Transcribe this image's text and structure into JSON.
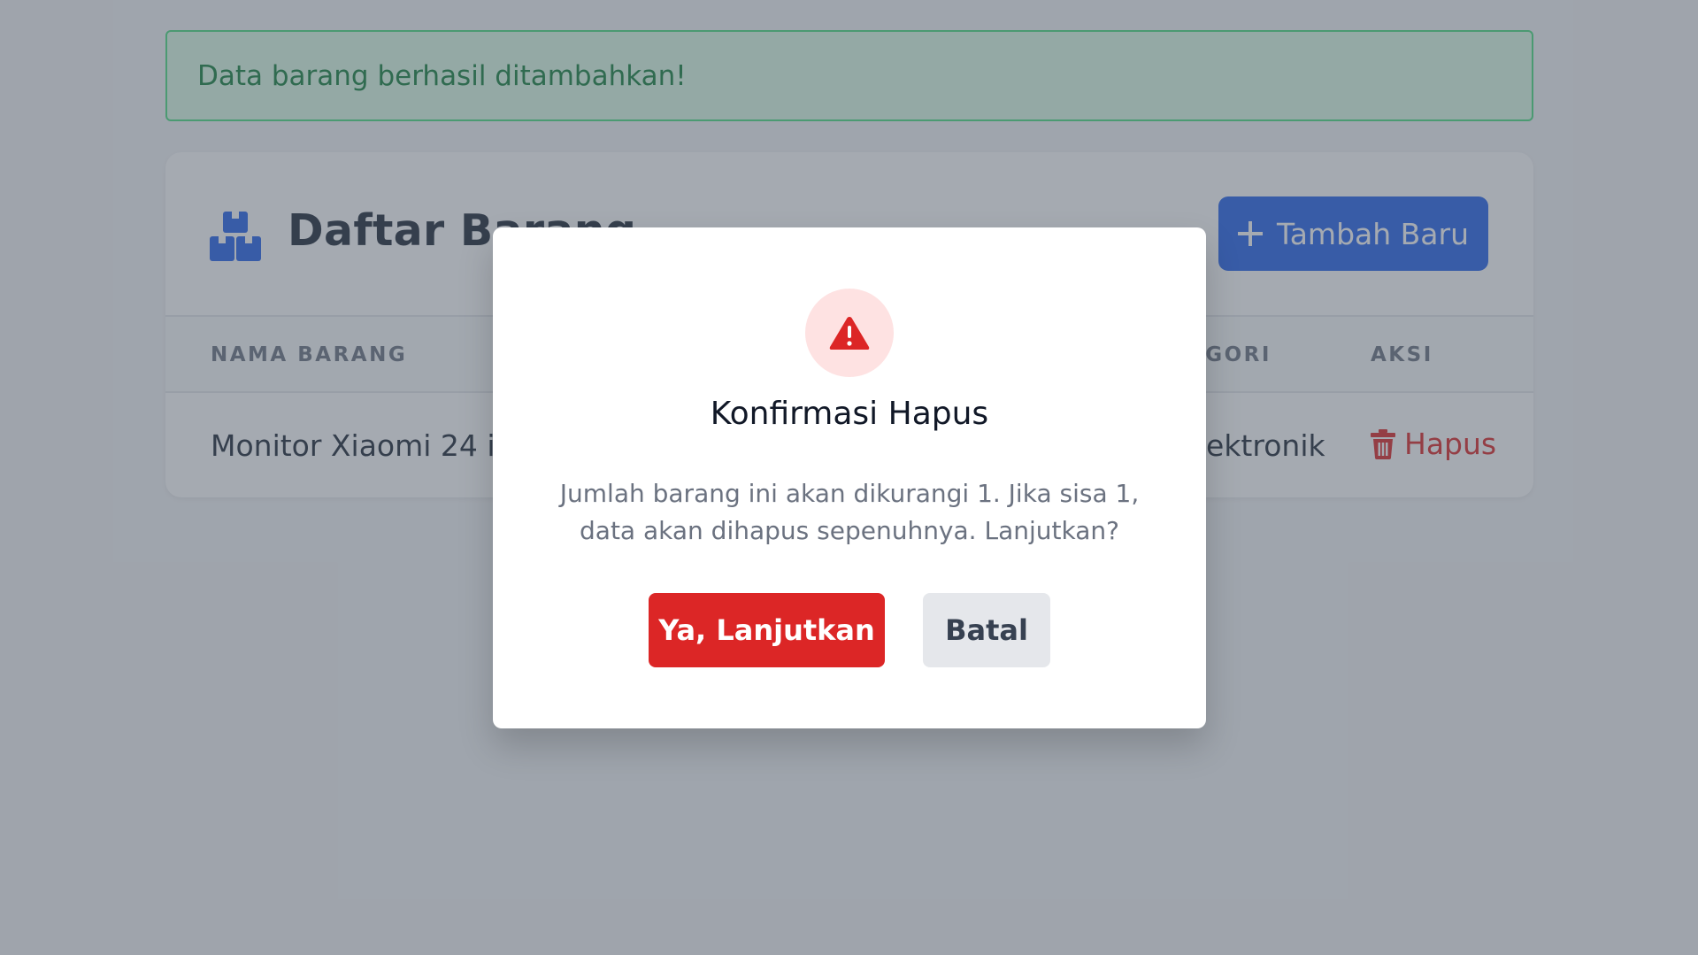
{
  "alert": {
    "message": "Data barang berhasil ditambahkan!"
  },
  "card": {
    "icon": "boxes-icon",
    "title": "Daftar Barang",
    "add_button": {
      "icon": "plus-icon",
      "label": "Tambah Baru"
    },
    "table": {
      "columns": {
        "name": "NAMA BARANG",
        "category": "KATEGORI",
        "action": "AKSI"
      },
      "rows": [
        {
          "name": "Monitor Xiaomi 24 inch",
          "category": "Elektronik",
          "action": {
            "icon": "trash-icon",
            "label": "Hapus"
          }
        }
      ]
    }
  },
  "modal": {
    "icon": "warning-triangle-icon",
    "title": "Konfirmasi Hapus",
    "message": "Jumlah barang ini akan dikurangi 1. Jika sisa 1, data akan dihapus sepenuhnya. Lanjutkan?",
    "confirm_label": "Ya, Lanjutkan",
    "cancel_label": "Batal"
  },
  "colors": {
    "primary": "#2563eb",
    "danger": "#dc2626",
    "success": "#15803d",
    "success_bg": "#dcfce7",
    "overlay": "#4b5563"
  }
}
